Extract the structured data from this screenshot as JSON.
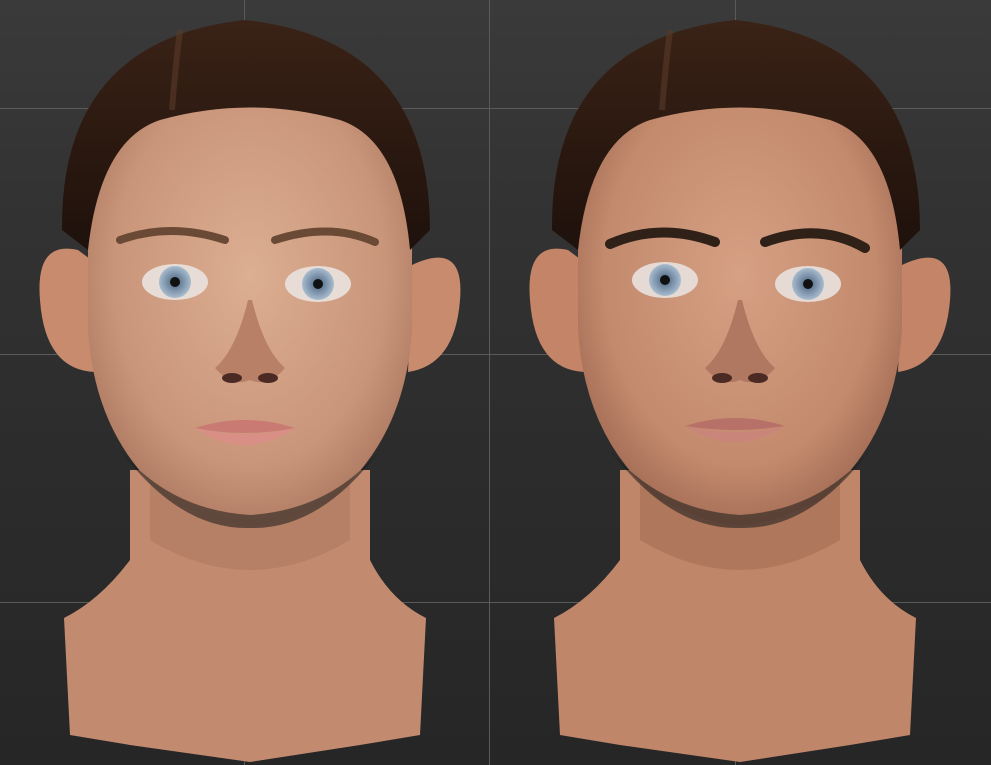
{
  "viewport": {
    "background_top": "#3a3a3a",
    "background_bottom": "#262626",
    "grid_color": "#5a5a5a"
  },
  "models": [
    {
      "name": "head-model-left",
      "skin_color": "#c9957a",
      "hair_color": "#2a1710",
      "lip_color": "#d98e86",
      "eye_color": "#8fa6bf",
      "brow_color": "#6b4a35"
    },
    {
      "name": "head-model-right",
      "skin_color": "#c38a6d",
      "hair_color": "#2a1710",
      "lip_color": "#c98579",
      "eye_color": "#8fa6bf",
      "brow_color": "#2f2018"
    }
  ]
}
